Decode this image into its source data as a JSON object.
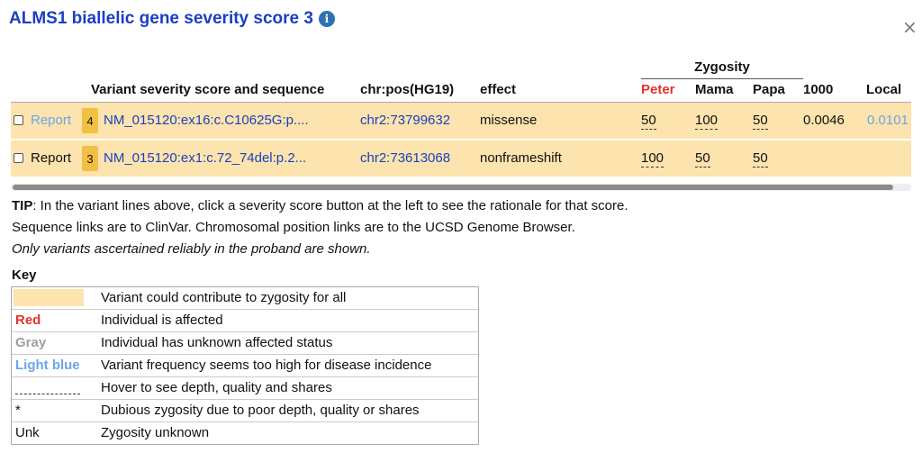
{
  "dialog": {
    "title": "ALMS1 biallelic gene severity score 3",
    "info_glyph": "i",
    "close_glyph": "×"
  },
  "table": {
    "zygosity_header": "Zygosity",
    "headers": {
      "variant": "Variant severity score and sequence",
      "chrpos": "chr:pos(HG19)",
      "effect": "effect",
      "peter": "Peter",
      "mama": "Mama",
      "papa": "Papa",
      "f1000": "1000",
      "local": "Local"
    },
    "rows": [
      {
        "report": "Report",
        "score": "4",
        "sequence": "NM_015120:ex16:c.C10625G:p....",
        "chrpos": "chr2:73799632",
        "effect": "missense",
        "peter": "50",
        "mama": "100",
        "papa": "50",
        "f1000": "0.0046",
        "local": "0.0101"
      },
      {
        "report": "Report",
        "score": "3",
        "sequence": "NM_015120:ex1:c.72_74del:p.2...",
        "chrpos": "chr2:73613068",
        "effect": "nonframeshift",
        "peter": "100",
        "mama": "50",
        "papa": "50",
        "f1000": "",
        "local": ""
      }
    ]
  },
  "tips": {
    "tip_label": "TIP",
    "tip_text": ": In the variant lines above, click a severity score button at the left to see the rationale for that score.",
    "line2": "Sequence links are to ClinVar. Chromosomal position links are to the UCSD Genome Browser.",
    "line3": "Only variants ascertained reliably in the proband are shown."
  },
  "key": {
    "title": "Key",
    "rows": [
      {
        "label": "",
        "desc": "Variant could contribute to zygosity for all"
      },
      {
        "label": "Red",
        "desc": "Individual is affected"
      },
      {
        "label": "Gray",
        "desc": "Individual has unknown affected status"
      },
      {
        "label": "Light blue",
        "desc": "Variant frequency seems too high for disease incidence"
      },
      {
        "label": "",
        "desc": "Hover to see depth, quality and shares"
      },
      {
        "label": "*",
        "desc": "Dubious zygosity due to poor depth, quality or shares"
      },
      {
        "label": "Unk",
        "desc": "Zygosity unknown"
      }
    ]
  },
  "colors": {
    "title_blue": "#1a3fc2",
    "row_highlight": "#fde3ad",
    "score_badge": "#f2c044",
    "affected_red": "#e5312b",
    "unknown_gray": "#a0a0a0",
    "light_blue": "#6aa6e8"
  }
}
